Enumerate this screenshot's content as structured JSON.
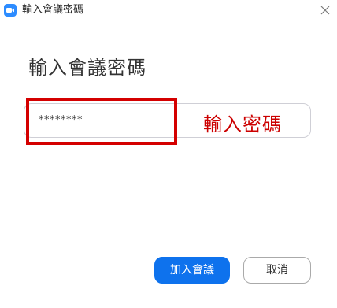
{
  "window": {
    "title": "輸入會議密碼"
  },
  "dialog": {
    "heading": "輸入會議密碼",
    "password_value": "********",
    "annotation": "輸入密碼"
  },
  "buttons": {
    "join_label": "加入會議",
    "cancel_label": "取消"
  },
  "icons": {
    "app": "zoom-camera-icon",
    "close": "close-icon"
  },
  "colors": {
    "primary": "#0E72ED",
    "app_icon": "#2D8CFF",
    "annotation": "#cc0000"
  }
}
